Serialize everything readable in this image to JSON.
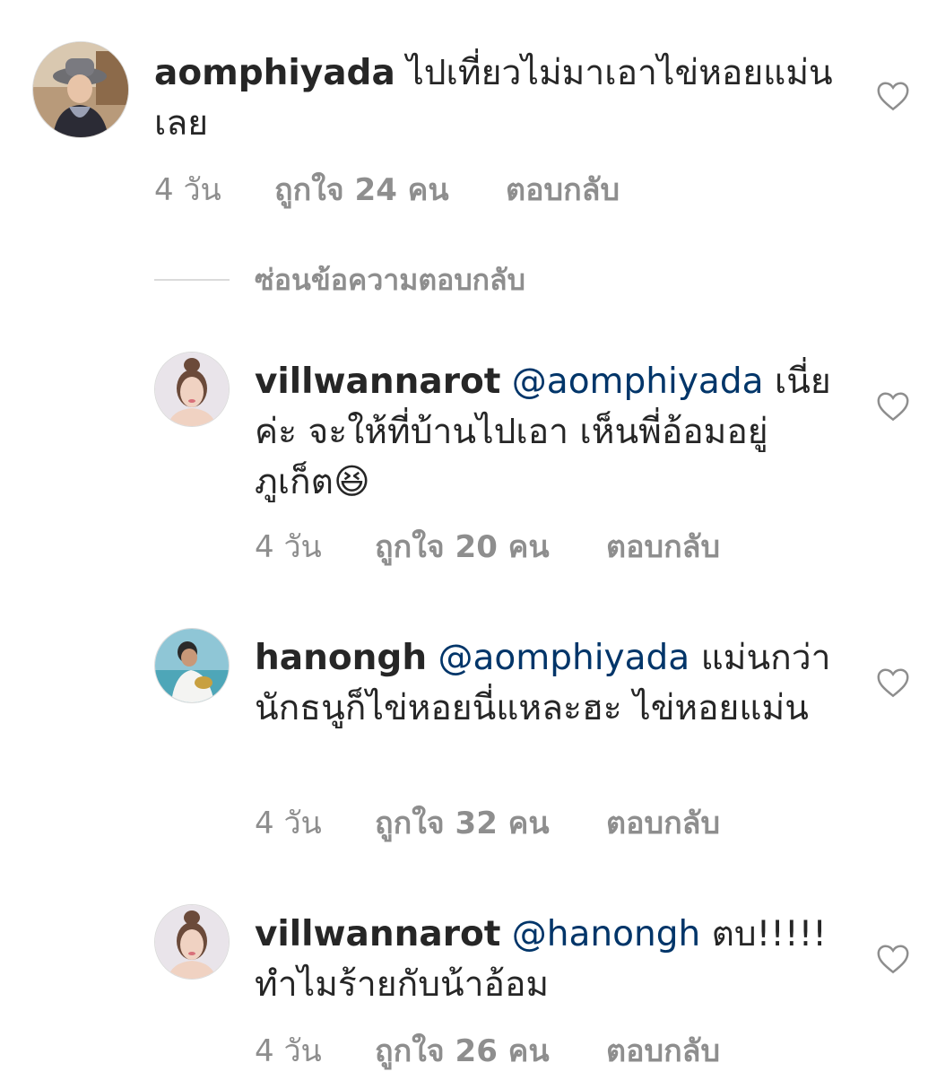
{
  "comments": [
    {
      "username": "aomphiyada",
      "mention": "",
      "text": "ไปเที่ยวไม่มาเอาไข่หอยแม่นเลย",
      "time": "4 วัน",
      "likes": "ถูกใจ 24 คน",
      "reply": "ตอบกลับ",
      "avatar_icon": "profile-photo-hat",
      "heart_icon": "heart-outline-icon"
    },
    {
      "username": "villwannarot",
      "mention": "@aomphiyada",
      "text": "เนี่ยค่ะ จะให้ที่บ้านไปเอา เห็นพี่อ้อมอยู่ภูเก็ต😆",
      "time": "4 วัน",
      "likes": "ถูกใจ 20 คน",
      "reply": "ตอบกลับ",
      "avatar_icon": "profile-photo-portrait",
      "heart_icon": "heart-outline-icon"
    },
    {
      "username": "hanongh",
      "mention": "@aomphiyada",
      "text": "แม่นกว่า นักธนูก็ไข่หอยนี่แหละฮะ ไข่หอยแม่น",
      "time": "4 วัน",
      "likes": "ถูกใจ 32 คน",
      "reply": "ตอบกลับ",
      "avatar_icon": "profile-photo-beach",
      "heart_icon": "heart-outline-icon"
    },
    {
      "username": "villwannarot",
      "mention": "@hanongh",
      "text": "ตบ!!!!! ทำไมร้ายกับน้าอ้อม",
      "time": "4 วัน",
      "likes": "ถูกใจ 26 คน",
      "reply": "ตอบกลับ",
      "avatar_icon": "profile-photo-portrait",
      "heart_icon": "heart-outline-icon"
    }
  ],
  "hide_replies_label": "ซ่อนข้อความตอบกลับ",
  "colors": {
    "text": "#262626",
    "mention": "#003569",
    "muted": "#8e8e8e",
    "divider": "#dbdbdb"
  }
}
